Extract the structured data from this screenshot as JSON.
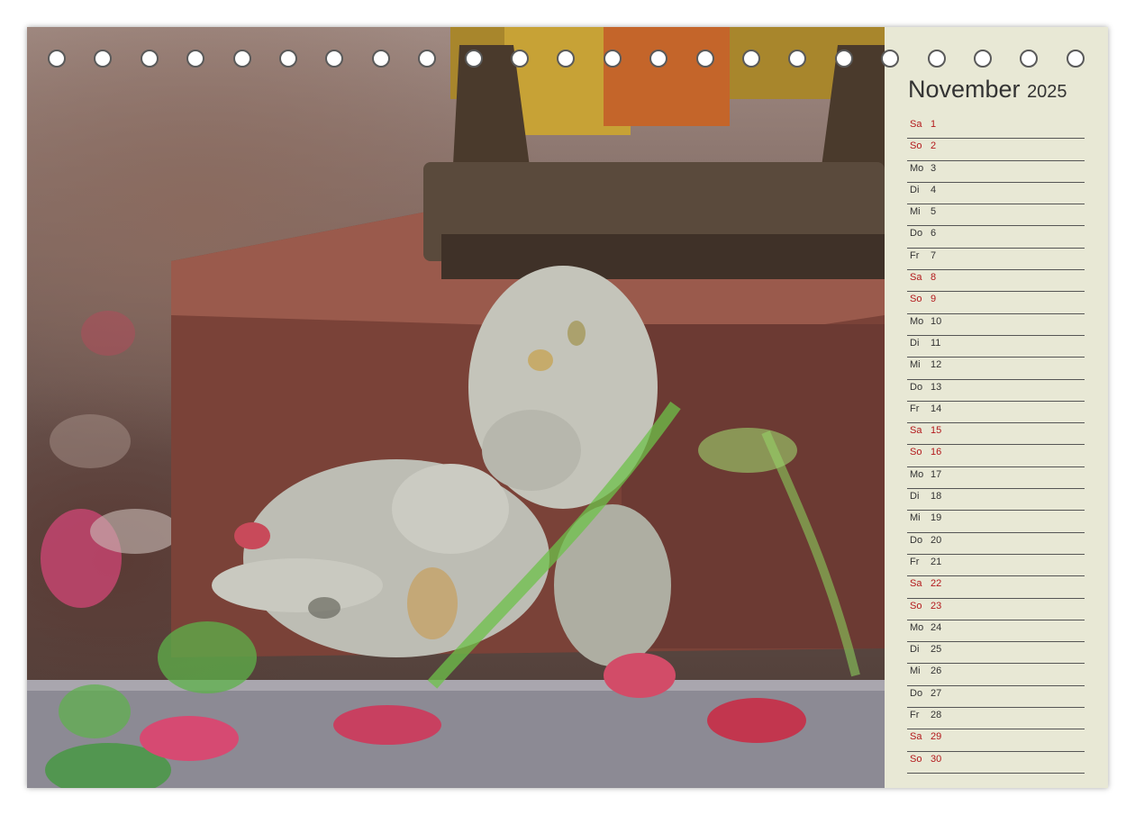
{
  "calendar": {
    "month": "November",
    "year": "2025",
    "accent_color": "#b3191c",
    "days": [
      {
        "weekday": "Sa",
        "day": "1",
        "weekend": true
      },
      {
        "weekday": "So",
        "day": "2",
        "weekend": true
      },
      {
        "weekday": "Mo",
        "day": "3",
        "weekend": false
      },
      {
        "weekday": "Di",
        "day": "4",
        "weekend": false
      },
      {
        "weekday": "Mi",
        "day": "5",
        "weekend": false
      },
      {
        "weekday": "Do",
        "day": "6",
        "weekend": false
      },
      {
        "weekday": "Fr",
        "day": "7",
        "weekend": false
      },
      {
        "weekday": "Sa",
        "day": "8",
        "weekend": true
      },
      {
        "weekday": "So",
        "day": "9",
        "weekend": true
      },
      {
        "weekday": "Mo",
        "day": "10",
        "weekend": false
      },
      {
        "weekday": "Di",
        "day": "11",
        "weekend": false
      },
      {
        "weekday": "Mi",
        "day": "12",
        "weekend": false
      },
      {
        "weekday": "Do",
        "day": "13",
        "weekend": false
      },
      {
        "weekday": "Fr",
        "day": "14",
        "weekend": false
      },
      {
        "weekday": "Sa",
        "day": "15",
        "weekend": true
      },
      {
        "weekday": "So",
        "day": "16",
        "weekend": true
      },
      {
        "weekday": "Mo",
        "day": "17",
        "weekend": false
      },
      {
        "weekday": "Di",
        "day": "18",
        "weekend": false
      },
      {
        "weekday": "Mi",
        "day": "19",
        "weekend": false
      },
      {
        "weekday": "Do",
        "day": "20",
        "weekend": false
      },
      {
        "weekday": "Fr",
        "day": "21",
        "weekend": false
      },
      {
        "weekday": "Sa",
        "day": "22",
        "weekend": true
      },
      {
        "weekday": "So",
        "day": "23",
        "weekend": true
      },
      {
        "weekday": "Mo",
        "day": "24",
        "weekend": false
      },
      {
        "weekday": "Di",
        "day": "25",
        "weekend": false
      },
      {
        "weekday": "Mi",
        "day": "26",
        "weekend": false
      },
      {
        "weekday": "Do",
        "day": "27",
        "weekend": false
      },
      {
        "weekday": "Fr",
        "day": "28",
        "weekend": false
      },
      {
        "weekday": "Sa",
        "day": "29",
        "weekend": true
      },
      {
        "weekday": "So",
        "day": "30",
        "weekend": true
      }
    ]
  },
  "binding": {
    "hole_count": 23
  }
}
